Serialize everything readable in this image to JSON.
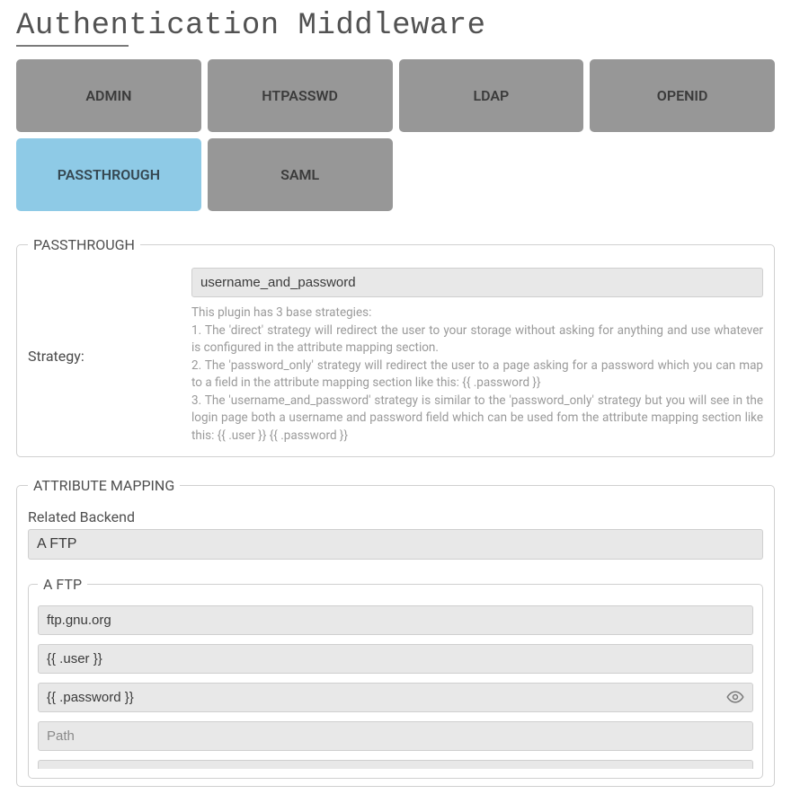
{
  "page": {
    "title": "Authentication Middleware",
    "title_underline_portion": "Authen"
  },
  "tabs": [
    {
      "label": "ADMIN",
      "active": false
    },
    {
      "label": "HTPASSWD",
      "active": false
    },
    {
      "label": "LDAP",
      "active": false
    },
    {
      "label": "OPENID",
      "active": false
    },
    {
      "label": "PASSTHROUGH",
      "active": true
    },
    {
      "label": "SAML",
      "active": false
    }
  ],
  "passthrough": {
    "legend": "PASSTHROUGH",
    "strategy_label": "Strategy:",
    "strategy_value": "username_and_password",
    "help_lines": [
      "This plugin has 3 base strategies:",
      "1. The 'direct' strategy will redirect the user to your storage without asking for anything and use whatever is configured in the attribute mapping section.",
      "2. The 'password_only' strategy will redirect the user to a page asking for a password which you can map to a field in the attribute mapping section like this: {{ .password }}",
      "3. The 'username_and_password' strategy is similar to the 'password_only' strategy but you will see in the login page both a username and password field which can be used fom the attribute mapping section like this: {{ .user }} {{ .password }}"
    ]
  },
  "attribute_mapping": {
    "legend": "ATTRIBUTE MAPPING",
    "related_backend_label": "Related Backend",
    "related_backend_value": "A FTP",
    "backend": {
      "legend": "A FTP",
      "fields": {
        "host_value": "ftp.gnu.org",
        "user_value": "{{ .user }}",
        "password_value": "{{ .password }}",
        "path_placeholder": "Path"
      }
    }
  }
}
